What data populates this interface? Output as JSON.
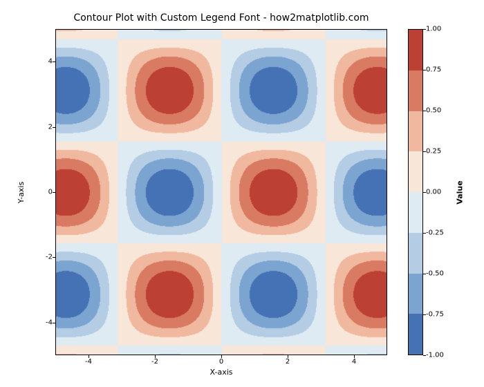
{
  "chart_data": {
    "type": "heatmap",
    "title": "Contour Plot with Custom Legend Font - how2matplotlib.com",
    "xlabel": "X-axis",
    "ylabel": "Y-axis",
    "cbar_label": "Value",
    "xlim": [
      -5,
      5
    ],
    "ylim": [
      -5,
      5
    ],
    "xticks": [
      -4,
      -2,
      0,
      2,
      4
    ],
    "yticks": [
      -4,
      -2,
      0,
      2,
      4
    ],
    "cbar_ticks": [
      -1.0,
      -0.75,
      -0.5,
      -0.25,
      0.0,
      0.25,
      0.5,
      0.75,
      1.0
    ],
    "cbar_min": -1.0,
    "cbar_max": 1.0,
    "function": "sin(x) * cos(y)",
    "levels": [
      -1.0,
      -0.75,
      -0.5,
      -0.25,
      0.0,
      0.25,
      0.5,
      0.75,
      1.0
    ],
    "colors": [
      "#4472b4",
      "#7ba4d1",
      "#b4cde4",
      "#dfebf3",
      "#f8e6d9",
      "#f0b89f",
      "#d97a62",
      "#bc4034"
    ],
    "grid_resolution": 16
  }
}
